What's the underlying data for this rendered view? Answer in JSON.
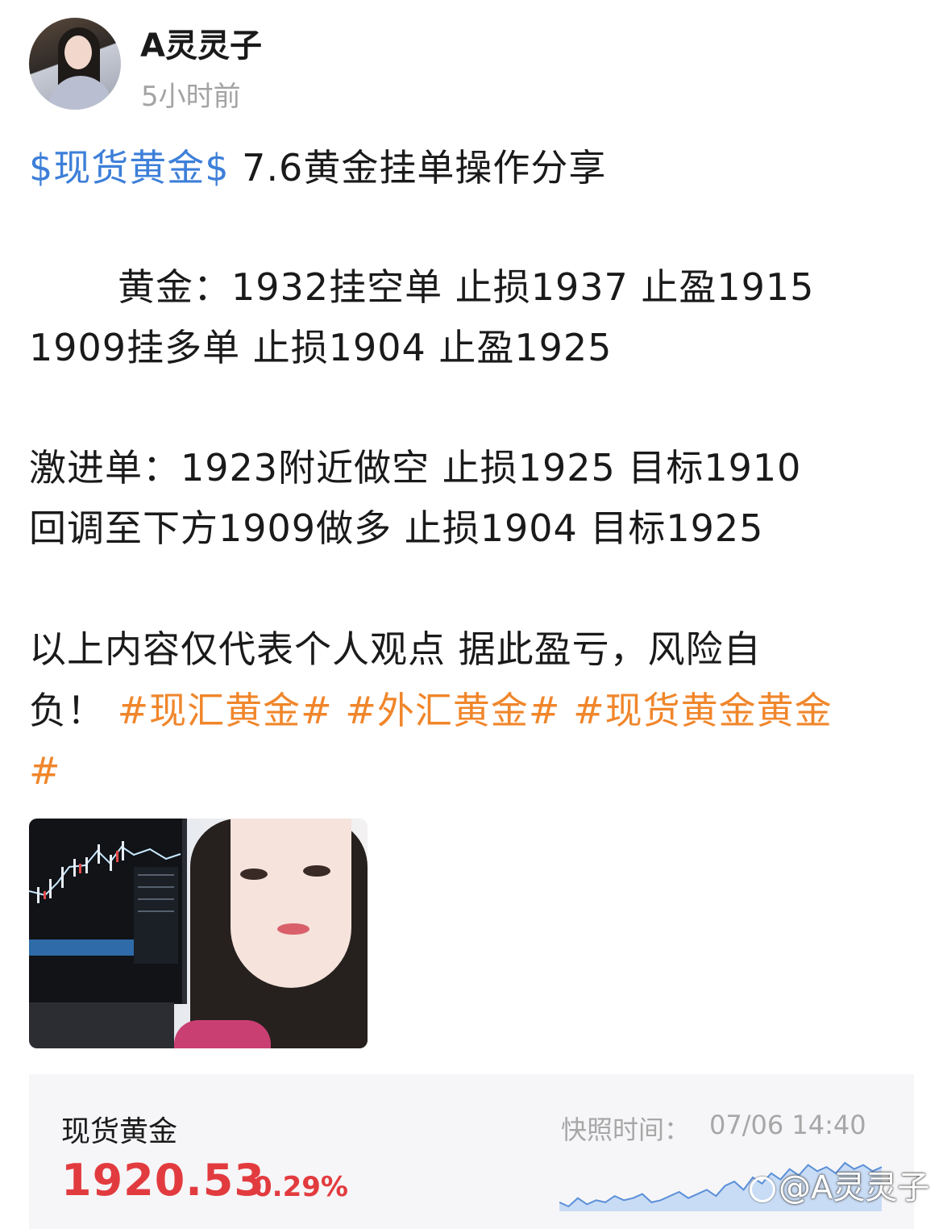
{
  "post": {
    "author": "A灵灵子",
    "time": "5小时前",
    "stock_tag": "$现货黄金$",
    "title": "7.6黄金挂单操作分享",
    "lines": {
      "l1": "黄金：1932挂空单 止损1937 止盈1915",
      "l2": "1909挂多单 止损1904 止盈1925",
      "l3": "激进单：1923附近做空 止损1925 目标1910",
      "l4": "回调至下方1909做多 止损1904 目标1925",
      "l5": "以上内容仅代表个人观点 据此盈亏，风险自",
      "l6_prefix": "负！"
    },
    "hashtags": [
      "#现汇黄金#",
      "#外汇黄金#",
      "#现货黄金黄金",
      "#"
    ]
  },
  "quote": {
    "name": "现货黄金",
    "price": "1920.53",
    "change": "0.29%",
    "snapshot_label": "快照时间：",
    "snapshot_time": "07/06 14:40",
    "sparkline": [
      12,
      10,
      14,
      11,
      13,
      12,
      15,
      13,
      14,
      16,
      12,
      13,
      15,
      17,
      14,
      16,
      18,
      15,
      20,
      22,
      18,
      24,
      21,
      26,
      23,
      28,
      25,
      30,
      27,
      29,
      26,
      31,
      28,
      30,
      27,
      29
    ],
    "colors": {
      "price": "#e23b3f",
      "line": "#5a8fd8"
    }
  },
  "watermark": "@A灵灵子",
  "icons": {
    "avatar": "user-avatar",
    "watermark": "weibo-logo-icon"
  }
}
